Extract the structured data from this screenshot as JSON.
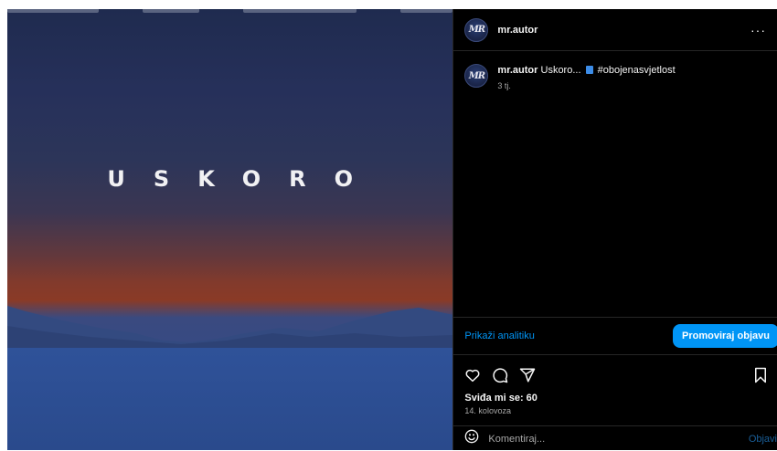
{
  "image": {
    "text": "USKORO"
  },
  "author": {
    "avatar_initials": "MR",
    "username": "mr.autor"
  },
  "header": {
    "more_label": "···"
  },
  "caption": {
    "username": "mr.autor",
    "text_before": " Uskoro... ",
    "emoji_icon": "book-emoji",
    "hashtag": " #obojenasvjetlost",
    "time": "3 tj."
  },
  "analytics": {
    "link_label": "Prikaži analitiku",
    "promote_label": "Promoviraj objavu"
  },
  "actions": {
    "like_icon": "heart-icon",
    "comment_icon": "comment-icon",
    "share_icon": "share-icon",
    "save_icon": "bookmark-icon"
  },
  "stats": {
    "likes": "Sviđa mi se: 60",
    "date": "14. kolovoza"
  },
  "comment": {
    "placeholder": "Komentiraj...",
    "post_label": "Objavi"
  },
  "colors": {
    "accent": "#0095f6",
    "background": "#000000",
    "border": "#262626",
    "muted_text": "#a8a8a8"
  }
}
